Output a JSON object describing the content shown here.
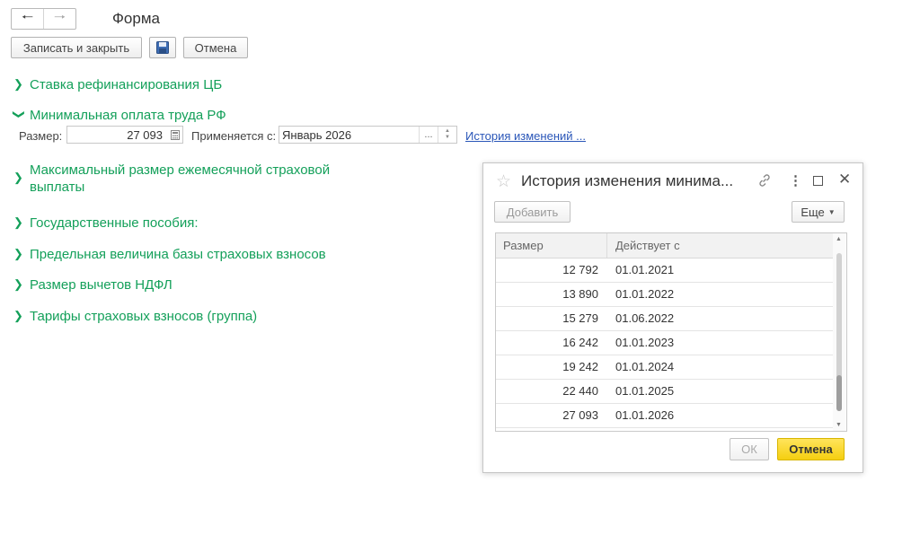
{
  "window": {
    "title": "Форма"
  },
  "toolbar": {
    "save_close": "Записать и закрыть",
    "cancel": "Отмена"
  },
  "groups": [
    {
      "label": "Ставка рефинансирования ЦБ",
      "expanded": false
    },
    {
      "label": "Минимальная оплата труда РФ",
      "expanded": true
    },
    {
      "label": "Максимальный размер ежемесячной страховой",
      "label2": "выплаты",
      "expanded": false
    },
    {
      "label": "Государственные пособия:",
      "expanded": false
    },
    {
      "label": "Предельная величина базы страховых взносов",
      "expanded": false
    },
    {
      "label": "Размер вычетов НДФЛ",
      "expanded": false
    },
    {
      "label": "Тарифы страховых взносов (группа)",
      "expanded": false
    }
  ],
  "mrot": {
    "size_label": "Размер:",
    "size_value": "27 093",
    "applies_label": "Применяется с:",
    "applies_value": "Январь 2026",
    "history_link": "История изменений ..."
  },
  "dialog": {
    "title": "История изменения минима...",
    "add": "Добавить",
    "more": "Еще",
    "columns": [
      "Размер",
      "Действует с"
    ],
    "rows": [
      {
        "size": "12 792",
        "date": "01.01.2021"
      },
      {
        "size": "13 890",
        "date": "01.01.2022"
      },
      {
        "size": "15 279",
        "date": "01.06.2022"
      },
      {
        "size": "16 242",
        "date": "01.01.2023"
      },
      {
        "size": "19 242",
        "date": "01.01.2024"
      },
      {
        "size": "22 440",
        "date": "01.01.2025"
      },
      {
        "size": "27 093",
        "date": "01.01.2026"
      }
    ],
    "ok": "ОК",
    "cancel": "Отмена"
  },
  "colors": {
    "group_text": "#14a05a",
    "link": "#2a56b8",
    "primary_button": "#f5cf10"
  }
}
